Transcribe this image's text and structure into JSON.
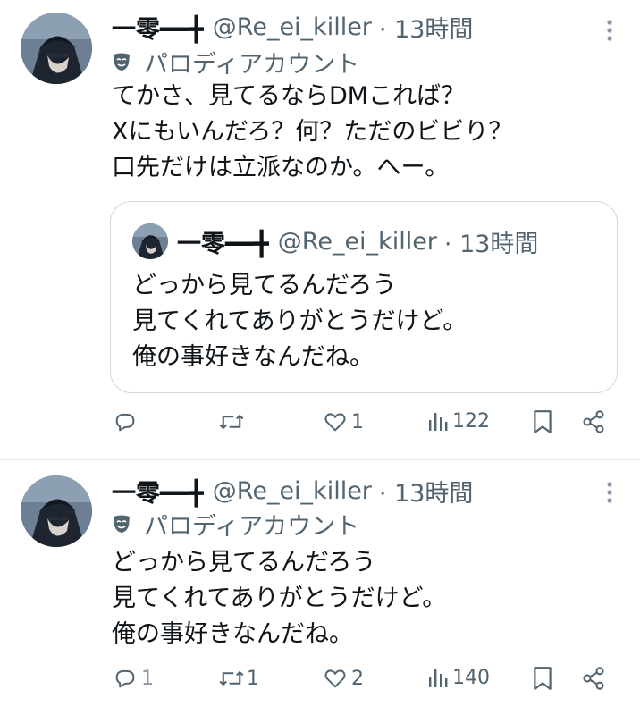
{
  "tweets": [
    {
      "name": "一零━━╋",
      "handle": "@Re_ei_killer",
      "time": "· 13時間",
      "label": "パロディアカウント",
      "text": "てかさ、見てるならDMこれば？\nXにもいんだろ？何？ただのビビり？\n口先だけは立派なのか。へー。",
      "quote": {
        "name": "一零━━╋",
        "handle": "@Re_ei_killer",
        "time": "· 13時間",
        "text": "どっから見てるんだろう\n見てくれてありがとうだけど。\n俺の事好きなんだね。"
      },
      "counts": {
        "reply": "",
        "retweet": "",
        "like": "1",
        "views": "122"
      }
    },
    {
      "name": "一零━━╋",
      "handle": "@Re_ei_killer",
      "time": "· 13時間",
      "label": "パロディアカウント",
      "text": "どっから見てるんだろう\n見てくれてありがとうだけど。\n俺の事好きなんだね。",
      "counts": {
        "reply": "1",
        "retweet": "1",
        "like": "2",
        "views": "140"
      }
    }
  ],
  "icons": [
    "more-icon",
    "parody-mask-icon",
    "reply-icon",
    "retweet-icon",
    "like-icon",
    "views-icon",
    "bookmark-icon",
    "share-icon"
  ],
  "colors": {
    "secondary": "#536471",
    "border": "#cfd9de"
  }
}
